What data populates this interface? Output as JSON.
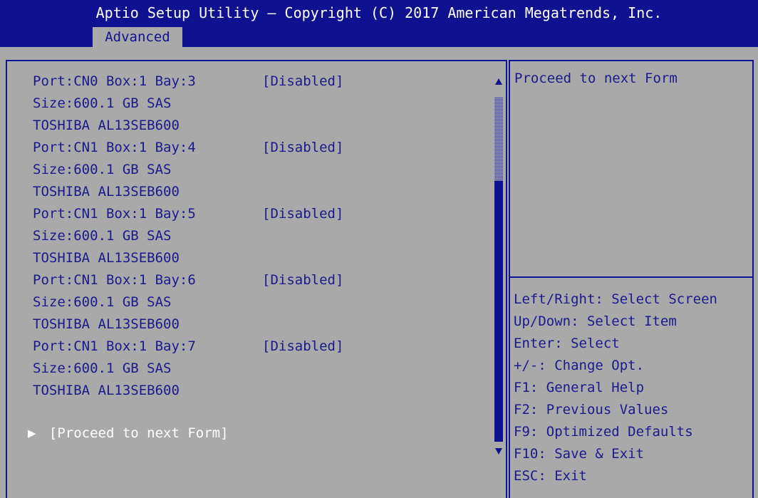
{
  "header": {
    "title": "Aptio Setup Utility – Copyright (C) 2017 American Megatrends, Inc.",
    "tab": "Advanced"
  },
  "devices": [
    {
      "port": "Port:CN0 Box:1 Bay:3",
      "value": "[Disabled]",
      "size": "Size:600.1 GB SAS",
      "model": "TOSHIBA AL13SEB600"
    },
    {
      "port": "Port:CN1 Box:1 Bay:4",
      "value": "[Disabled]",
      "size": "Size:600.1 GB SAS",
      "model": "TOSHIBA AL13SEB600"
    },
    {
      "port": "Port:CN1 Box:1 Bay:5",
      "value": "[Disabled]",
      "size": "Size:600.1 GB SAS",
      "model": "TOSHIBA AL13SEB600"
    },
    {
      "port": "Port:CN1 Box:1 Bay:6",
      "value": "[Disabled]",
      "size": "Size:600.1 GB SAS",
      "model": "TOSHIBA AL13SEB600"
    },
    {
      "port": "Port:CN1 Box:1 Bay:7",
      "value": "[Disabled]",
      "size": "Size:600.1 GB SAS",
      "model": "TOSHIBA AL13SEB600"
    }
  ],
  "proceed": {
    "label": "[Proceed to next Form]",
    "arrow_icon": "right-triangle"
  },
  "help": {
    "text": "Proceed to next Form"
  },
  "keys": [
    "Left/Right: Select Screen",
    "Up/Down: Select Item",
    "Enter: Select",
    "+/-: Change Opt.",
    "F1: General Help",
    "F2: Previous Values",
    "F9: Optimized Defaults",
    "F10: Save & Exit",
    "ESC: Exit"
  ],
  "colors": {
    "header_bg": "#0f1290",
    "body_bg": "#a9a9a9",
    "text": "#1a1a8c",
    "selected": "#ffffff"
  }
}
